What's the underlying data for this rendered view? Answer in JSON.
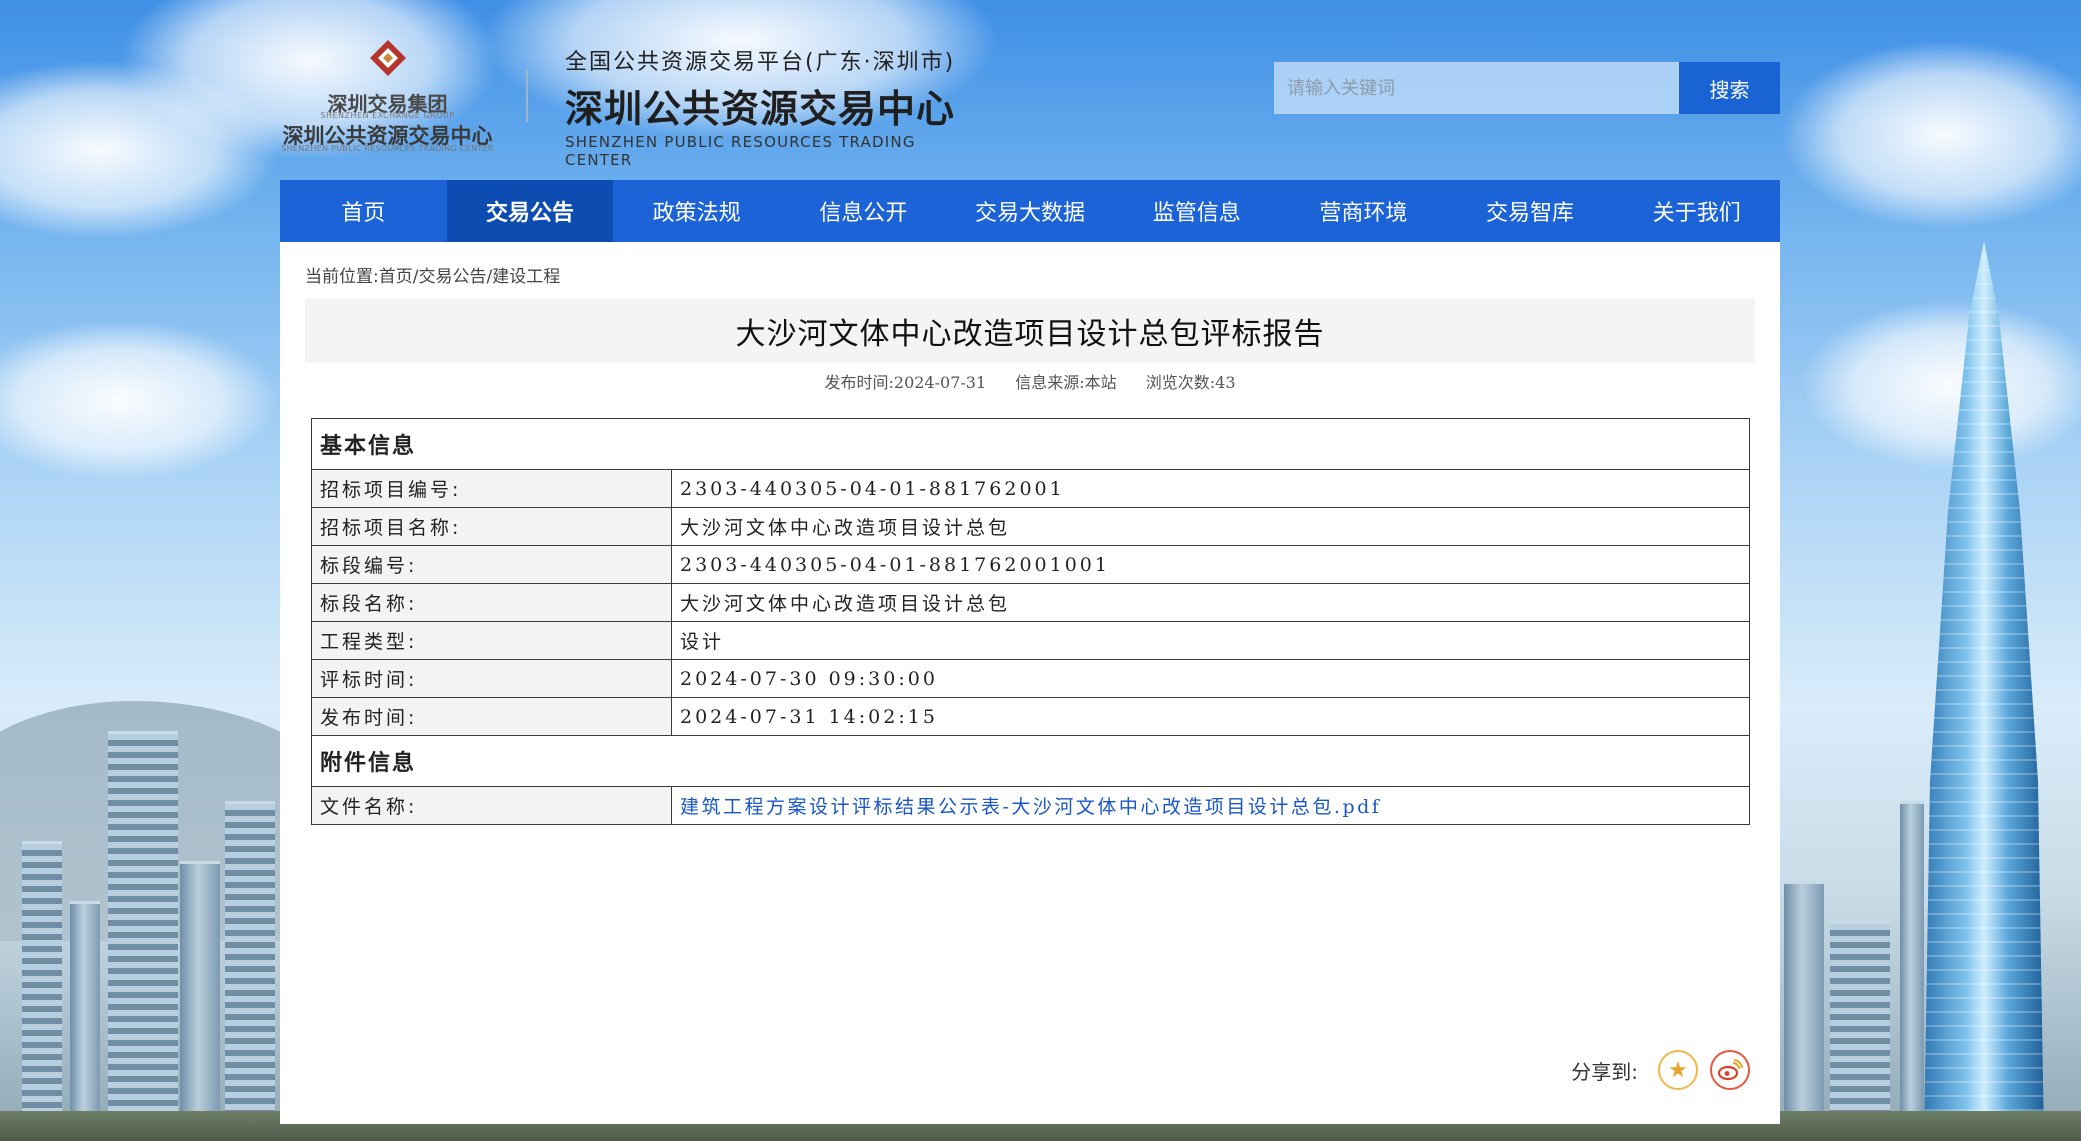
{
  "header": {
    "logo_cn_group": "深圳交易集团",
    "logo_en_group": "SHENZHEN EXCHANGE GROUP",
    "logo_cn_center": "深圳公共资源交易中心",
    "logo_en_center": "SHENZHEN PUBLIC RESOURCES TRADING CENTER",
    "platform_subtitle": "全国公共资源交易平台(广东·深圳市)",
    "platform_title": "深圳公共资源交易中心",
    "platform_en": "SHENZHEN PUBLIC RESOURCES TRADING CENTER",
    "search_placeholder": "请输入关键词",
    "search_button": "搜索"
  },
  "nav": {
    "items": [
      {
        "label": "首页"
      },
      {
        "label": "交易公告"
      },
      {
        "label": "政策法规"
      },
      {
        "label": "信息公开"
      },
      {
        "label": "交易大数据"
      },
      {
        "label": "监管信息"
      },
      {
        "label": "营商环境"
      },
      {
        "label": "交易智库"
      },
      {
        "label": "关于我们"
      }
    ],
    "active_index": 1
  },
  "breadcrumb": {
    "prefix": "当前位置:",
    "items": [
      "首页",
      "交易公告",
      "建设工程"
    ],
    "separator": "/"
  },
  "article": {
    "title": "大沙河文体中心改造项目设计总包评标报告",
    "publish_label": "发布时间:",
    "publish_date": "2024-07-31",
    "source_label": "信息来源:",
    "source": "本站",
    "views_label": "浏览次数:",
    "views": "43"
  },
  "basic_info": {
    "heading": "基本信息",
    "rows": [
      {
        "label": "招标项目编号:",
        "value": "2303-440305-04-01-881762001"
      },
      {
        "label": "招标项目名称:",
        "value": "大沙河文体中心改造项目设计总包"
      },
      {
        "label": "标段编号:",
        "value": "2303-440305-04-01-881762001001"
      },
      {
        "label": "标段名称:",
        "value": "大沙河文体中心改造项目设计总包"
      },
      {
        "label": "工程类型:",
        "value": "设计"
      },
      {
        "label": "评标时间:",
        "value": "2024-07-30 09:30:00"
      },
      {
        "label": "发布时间:",
        "value": "2024-07-31 14:02:15"
      }
    ]
  },
  "attachments": {
    "heading": "附件信息",
    "file_label": "文件名称:",
    "file_name": "建筑工程方案设计评标结果公示表-大沙河文体中心改造项目设计总包.pdf"
  },
  "share": {
    "label": "分享到:",
    "icons": [
      "favorite-star-icon",
      "weibo-icon"
    ]
  },
  "colors": {
    "nav_bg": "#1b63d6",
    "nav_active": "#0d4cb0",
    "search_button": "#1a63d4",
    "link": "#1a57c9"
  }
}
